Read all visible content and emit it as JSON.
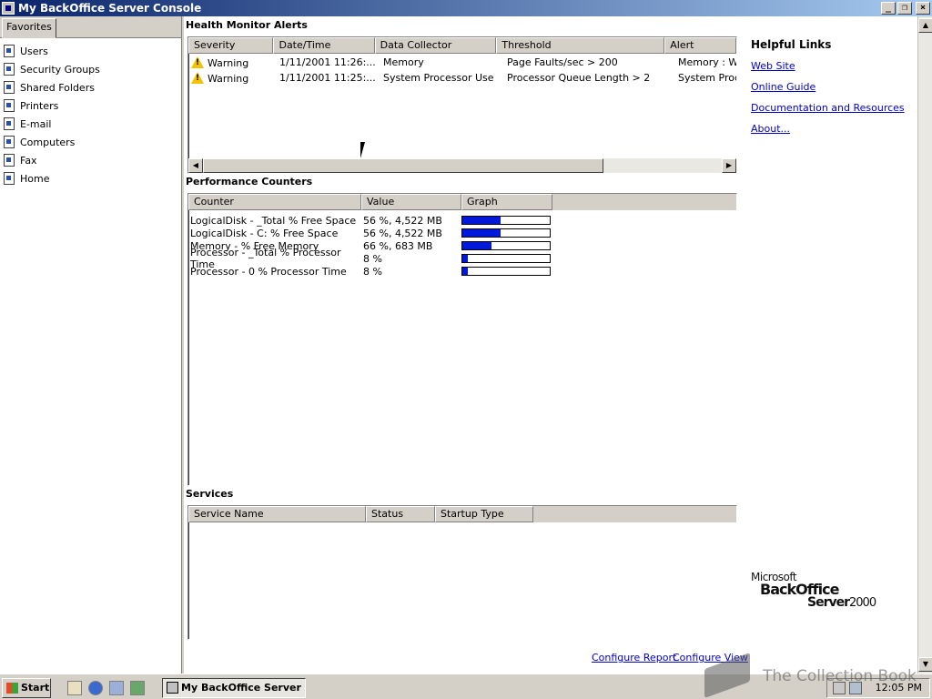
{
  "window": {
    "title": "My BackOffice Server Console"
  },
  "favorites": {
    "tab_label": "Favorites",
    "items": [
      "Users",
      "Security Groups",
      "Shared Folders",
      "Printers",
      "E-mail",
      "Computers",
      "Fax",
      "Home"
    ]
  },
  "health": {
    "title": "Health Monitor Alerts",
    "columns": [
      "Severity",
      "Date/Time",
      "Data Collector",
      "Threshold",
      "Alert"
    ],
    "rows": [
      {
        "severity": "Warning",
        "datetime": "1/11/2001 11:26:...",
        "collector": "Memory",
        "threshold": "Page Faults/sec > 200",
        "alert": "Memory : Wai"
      },
      {
        "severity": "Warning",
        "datetime": "1/11/2001 11:25:...",
        "collector": "System Processor Use",
        "threshold": "Processor Queue Length > 2",
        "alert": "System Proce"
      }
    ]
  },
  "performance": {
    "title": "Performance Counters",
    "columns": [
      "Counter",
      "Value",
      "Graph"
    ],
    "rows": [
      {
        "counter": "LogicalDisk - _Total % Free Space",
        "value": "56 %, 4,522 MB",
        "percent": 44
      },
      {
        "counter": "LogicalDisk - C: % Free Space",
        "value": "56 %, 4,522 MB",
        "percent": 44
      },
      {
        "counter": "Memory - % Free Memory",
        "value": "66 %, 683 MB",
        "percent": 33
      },
      {
        "counter": "Processor - _Total % Processor Time",
        "value": "8 %",
        "percent": 6
      },
      {
        "counter": "Processor - 0 % Processor Time",
        "value": "8 %",
        "percent": 6
      }
    ]
  },
  "services": {
    "title": "Services",
    "columns": [
      "Service Name",
      "Status",
      "Startup Type"
    ]
  },
  "helpful": {
    "title": "Helpful Links",
    "links": [
      "Web Site",
      "Online Guide",
      "Documentation and Resources",
      "About..."
    ]
  },
  "logo": {
    "line1": "Microsoft",
    "line2": "BackOffice",
    "line3": "Server",
    "year": "2000"
  },
  "footer": {
    "configure_report": "Configure Report",
    "configure_view": "Configure View"
  },
  "taskbar": {
    "start": "Start",
    "task_item": "My BackOffice Server ...",
    "clock": "12:05 PM"
  },
  "watermark": "The Collection Book",
  "colors": {
    "titlebar": "#0a246a",
    "link": "#0000cc",
    "graph_fill": "#0018d8"
  }
}
